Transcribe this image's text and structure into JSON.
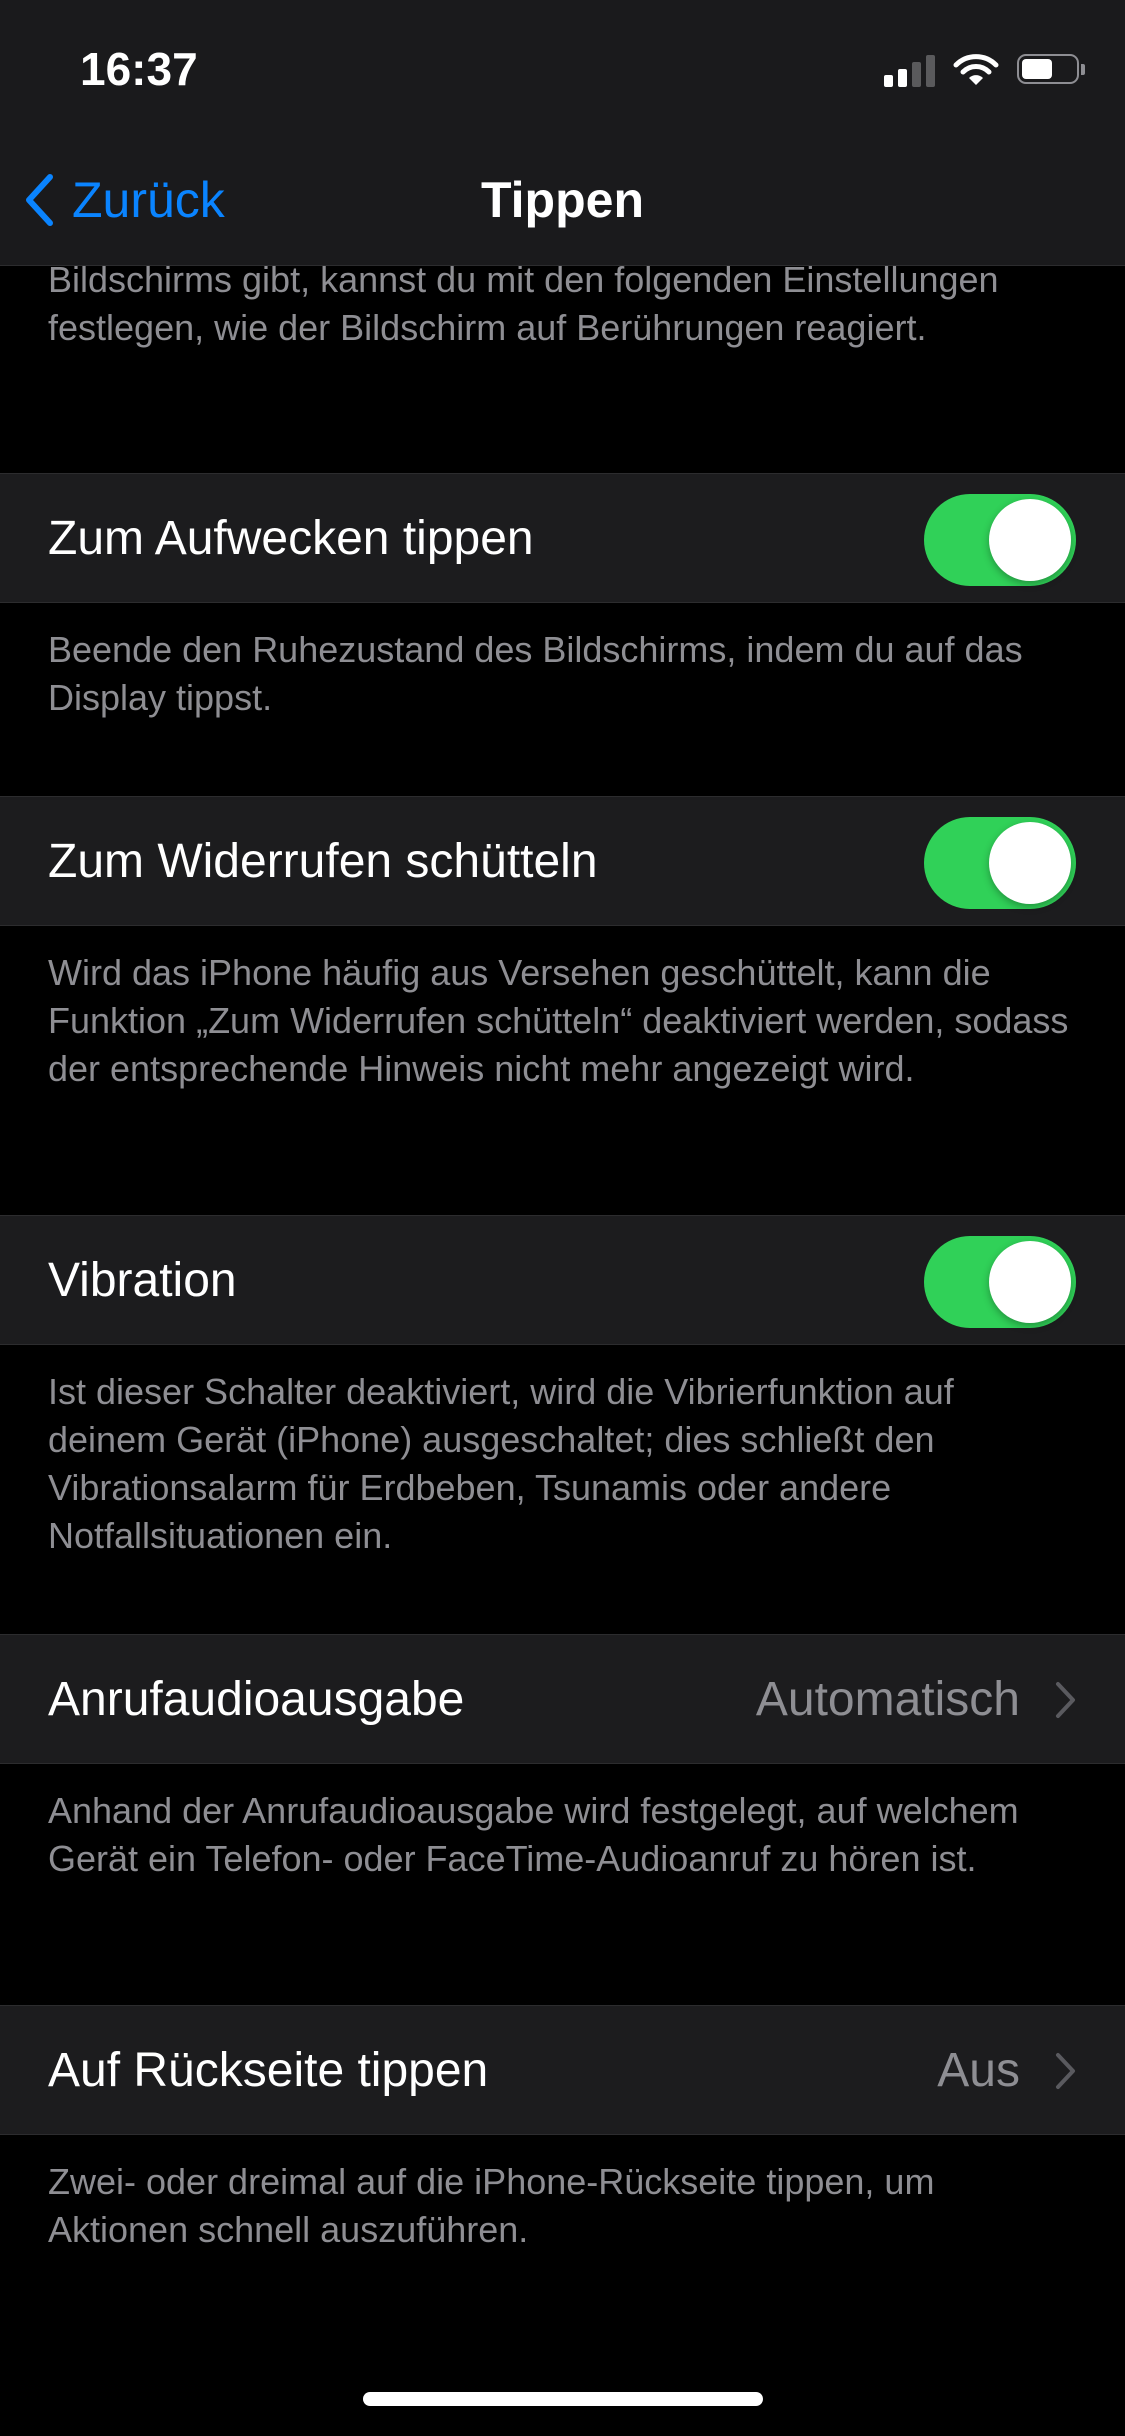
{
  "status_bar": {
    "time": "16:37"
  },
  "nav": {
    "back_label": "Zurück",
    "title": "Tippen"
  },
  "intro_text": "Bildschirms gibt, kannst du mit den folgenden Einstellungen festlegen, wie der Bildschirm auf Berührungen reagiert.",
  "settings": [
    {
      "label": "Zum Aufwecken tippen",
      "type": "toggle",
      "on": true,
      "description": "Beende den Ruhezustand des Bildschirms, indem du auf das Display tippst."
    },
    {
      "label": "Zum Widerrufen schütteln",
      "type": "toggle",
      "on": true,
      "description": "Wird das iPhone häufig aus Versehen geschüttelt, kann die Funktion „Zum Widerrufen schütteln“ deaktiviert werden, sodass der entsprechende Hinweis nicht mehr angezeigt wird."
    },
    {
      "label": "Vibration",
      "type": "toggle",
      "on": true,
      "description": "Ist dieser Schalter deaktiviert, wird die Vibrierfunktion auf deinem Gerät (iPhone) ausgeschaltet; dies schließt den Vibrationsalarm für Erdbeben, Tsunamis oder andere Notfallsituationen ein."
    },
    {
      "label": "Anrufaudioausgabe",
      "type": "disclosure",
      "value": "Automatisch",
      "description": "Anhand der Anrufaudioausgabe wird festgelegt, auf welchem Gerät ein Telefon- oder FaceTime-Audioanruf zu hören ist."
    },
    {
      "label": "Auf Rückseite tippen",
      "type": "disclosure",
      "value": "Aus",
      "description": "Zwei- oder dreimal auf die iPhone-Rückseite tippen, um Aktionen schnell auszuführen."
    }
  ],
  "colors": {
    "background": "#000000",
    "cell": "#1c1c1e",
    "accent": "#0a84ff",
    "toggle_on": "#30d158",
    "secondary_text": "#8e8e93"
  }
}
